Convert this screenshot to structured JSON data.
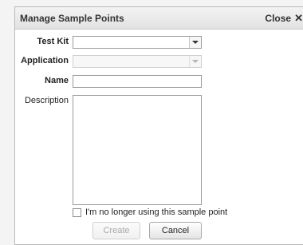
{
  "dialog": {
    "title": "Manage Sample Points",
    "close_label": "Close",
    "close_glyph": "✕"
  },
  "form": {
    "test_kit": {
      "label": "Test Kit",
      "value": ""
    },
    "application": {
      "label": "Application",
      "value": "",
      "disabled": true
    },
    "name": {
      "label": "Name",
      "value": ""
    },
    "description": {
      "label": "Description",
      "value": ""
    },
    "retire_checkbox": {
      "label": "I'm no longer using this sample point",
      "checked": false
    }
  },
  "buttons": {
    "create_label": "Create",
    "create_disabled": true,
    "cancel_label": "Cancel"
  }
}
